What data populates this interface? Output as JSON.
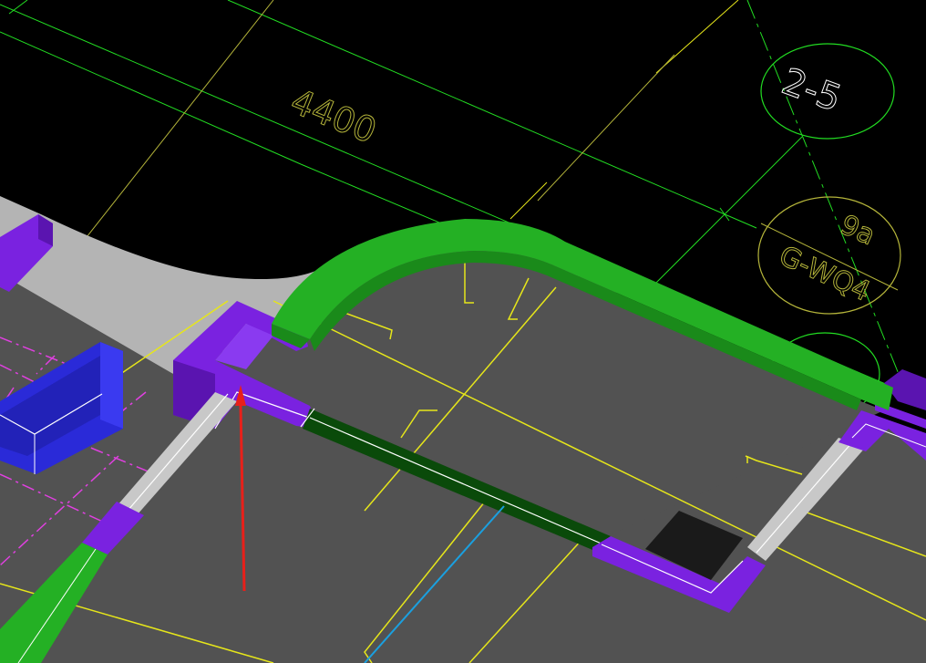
{
  "app": {
    "view": "3D CAD viewport"
  },
  "annotations": {
    "dimension": "4400",
    "grid_bubble_1": "2-5",
    "grid_bubble_2_top": "9a",
    "grid_bubble_2_bottom": "G-WQ4"
  },
  "colors": {
    "background": "#000000",
    "floor": "#525252",
    "floor_light": "#b4b4b4",
    "wall_purple": "#7a22e0",
    "wall_purple_dark": "#5a14b0",
    "beam_green": "#24b024",
    "beam_green_dark": "#1a8a1a",
    "wall_blue": "#2a2ad8",
    "opening_darkgreen": "#0a4a0a",
    "grid_green": "#22dd22",
    "axis_yellow": "#e6e61a",
    "dim_yellow": "#b4b43a",
    "hidden_magenta": "#e040e0",
    "pipe_cyan": "#1aa0e0",
    "pointer_red": "#e8201a",
    "white_edge": "#ffffff",
    "pit_black": "#1a1a1a"
  },
  "icons": {
    "pointer": "red-arrow-icon"
  }
}
